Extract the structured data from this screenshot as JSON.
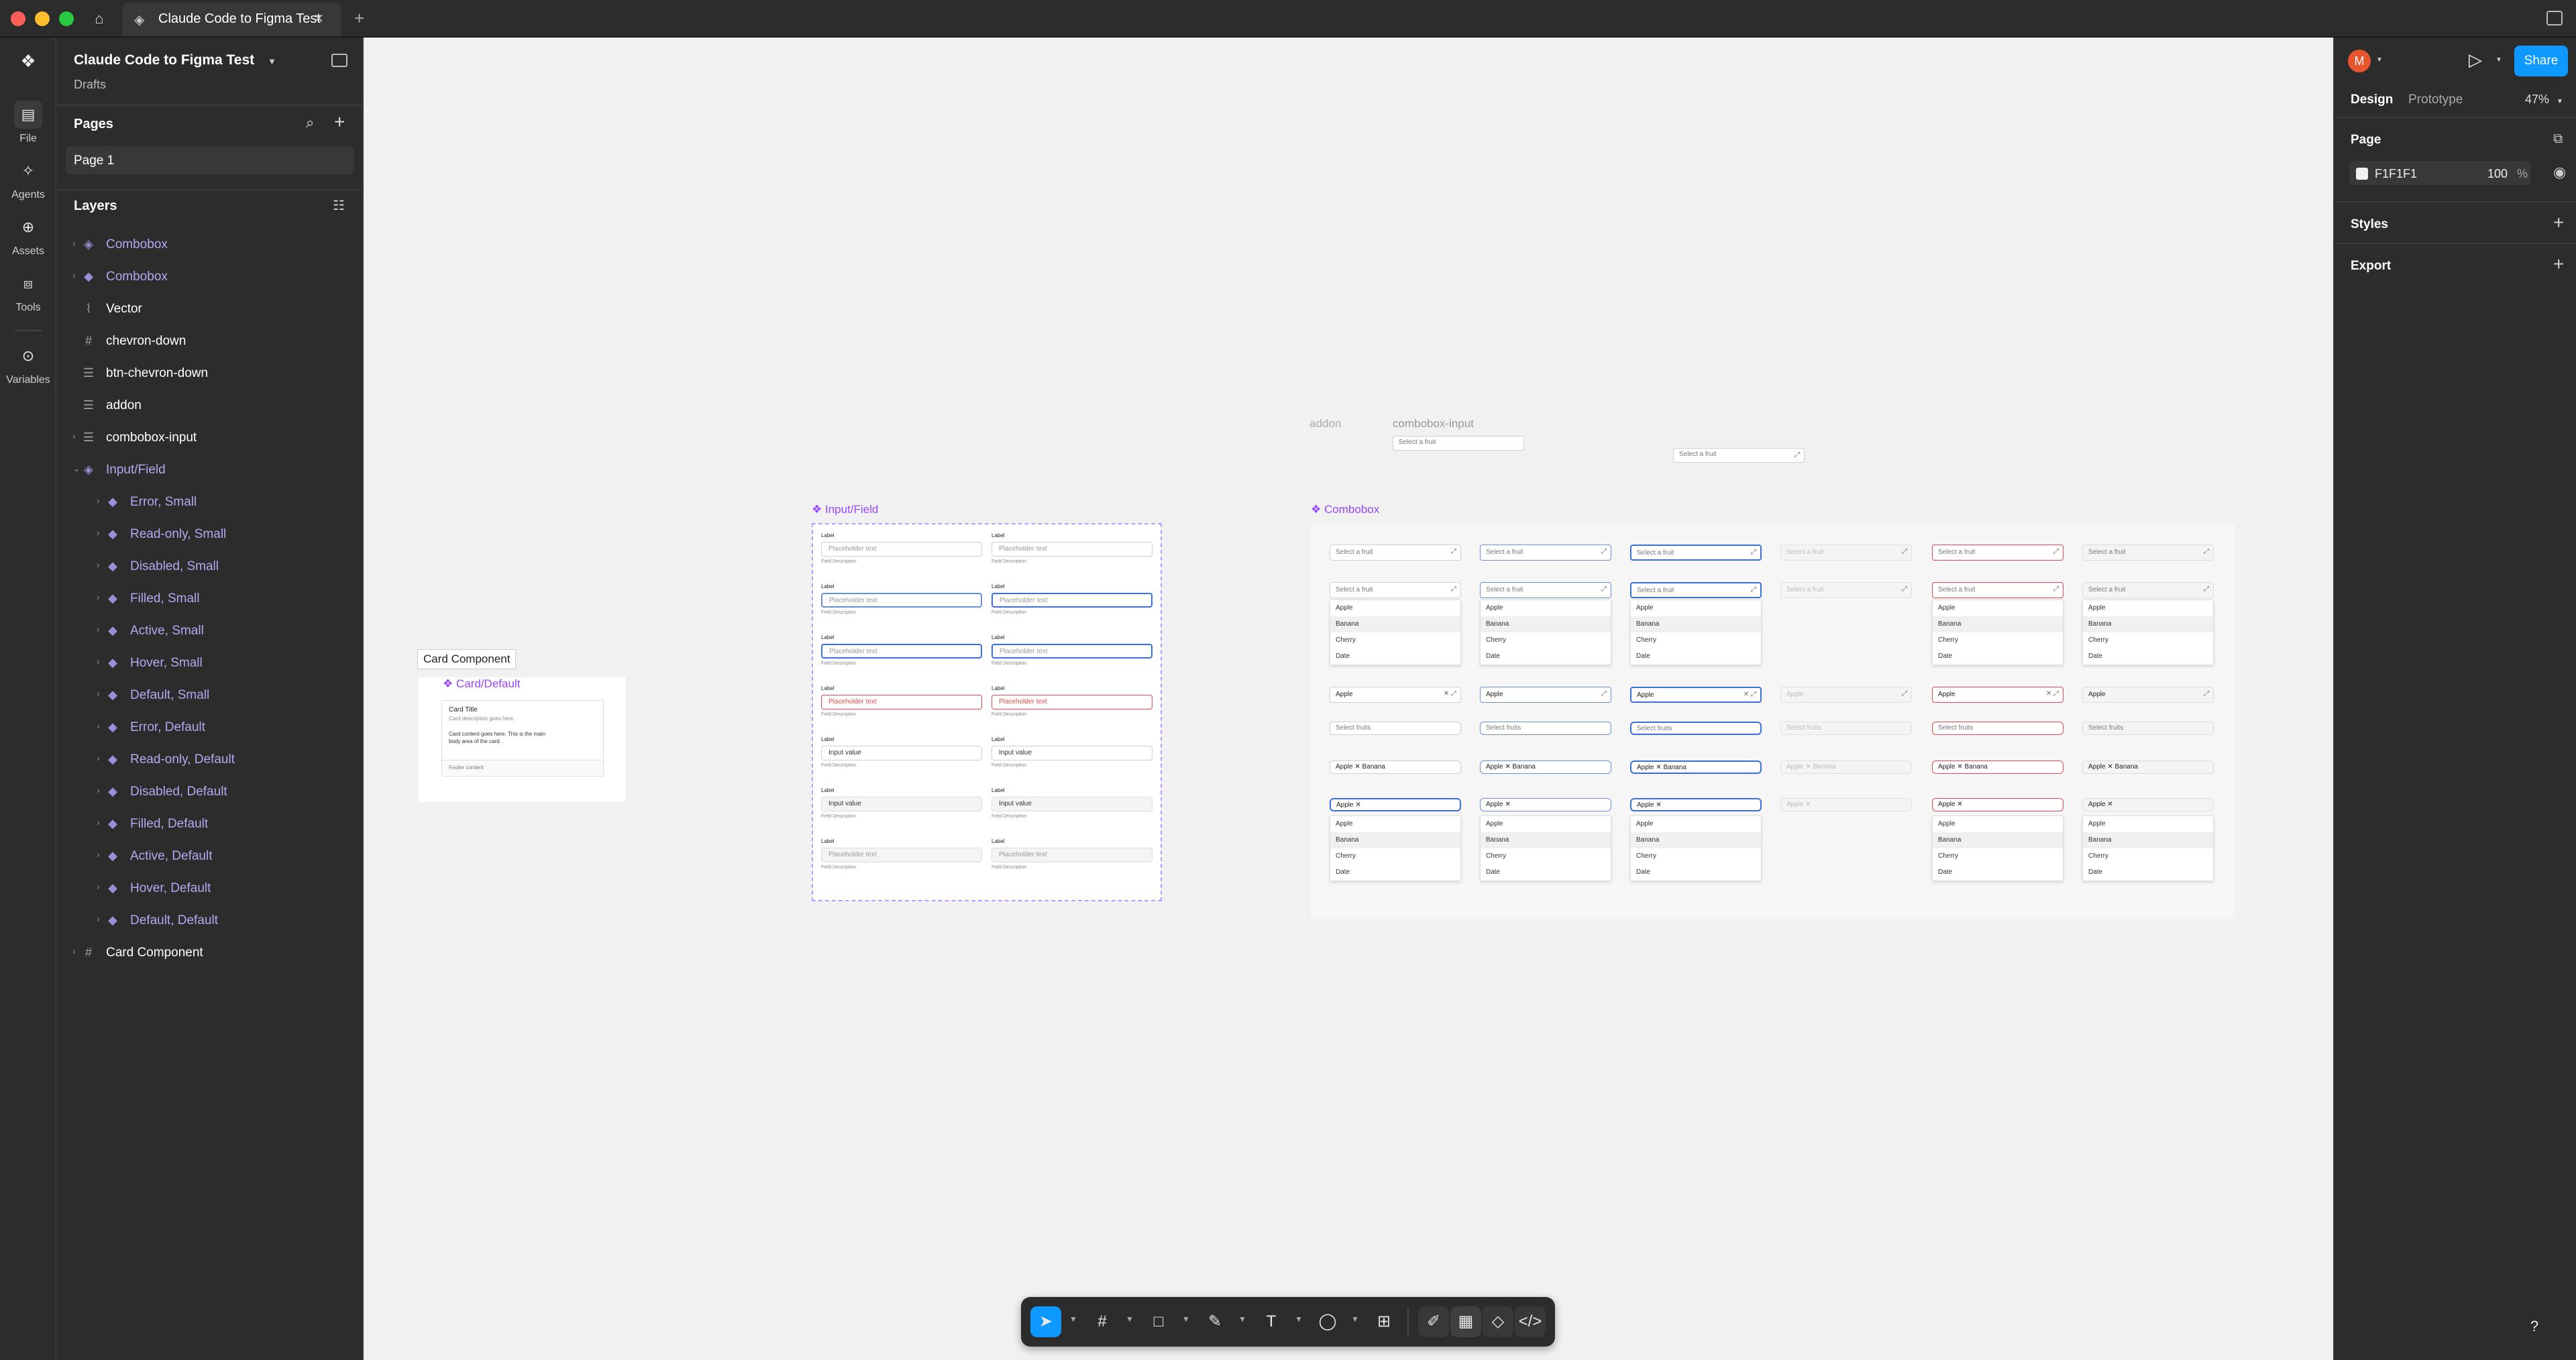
{
  "window": {
    "tab_title": "Claude Code to Figma Test",
    "new_tab": "+"
  },
  "rail": {
    "items": [
      {
        "label": "File",
        "icon": "file-icon"
      },
      {
        "label": "Agents",
        "icon": "agents-icon"
      },
      {
        "label": "Assets",
        "icon": "assets-icon"
      },
      {
        "label": "Tools",
        "icon": "tools-icon"
      },
      {
        "label": "Variables",
        "icon": "variables-icon"
      }
    ]
  },
  "file": {
    "name": "Claude Code to Figma Test",
    "location": "Drafts"
  },
  "pages": {
    "title": "Pages",
    "items": [
      "Page 1"
    ]
  },
  "layers": {
    "title": "Layers",
    "items": [
      {
        "label": "Combobox",
        "icon": "component-set-icon",
        "purple": true
      },
      {
        "label": "Combobox",
        "icon": "component-icon",
        "purple": true
      },
      {
        "label": "Vector",
        "icon": "vector-icon",
        "purple": false
      },
      {
        "label": "chevron-down",
        "icon": "frame-icon",
        "purple": false
      },
      {
        "label": "btn-chevron-down",
        "icon": "autolayout-icon",
        "purple": false
      },
      {
        "label": "addon",
        "icon": "autolayout-icon",
        "purple": false
      },
      {
        "label": "combobox-input",
        "icon": "autolayout-icon",
        "purple": false
      },
      {
        "label": "Input/Field",
        "icon": "component-set-icon",
        "purple": true
      },
      {
        "label": "Error, Small",
        "icon": "component-icon",
        "purple": true
      },
      {
        "label": "Read-only, Small",
        "icon": "component-icon",
        "purple": true
      },
      {
        "label": "Disabled, Small",
        "icon": "component-icon",
        "purple": true
      },
      {
        "label": "Filled, Small",
        "icon": "component-icon",
        "purple": true
      },
      {
        "label": "Active, Small",
        "icon": "component-icon",
        "purple": true
      },
      {
        "label": "Hover, Small",
        "icon": "component-icon",
        "purple": true
      },
      {
        "label": "Default, Small",
        "icon": "component-icon",
        "purple": true
      },
      {
        "label": "Error, Default",
        "icon": "component-icon",
        "purple": true
      },
      {
        "label": "Read-only, Default",
        "icon": "component-icon",
        "purple": true
      },
      {
        "label": "Disabled, Default",
        "icon": "component-icon",
        "purple": true
      },
      {
        "label": "Filled, Default",
        "icon": "component-icon",
        "purple": true
      },
      {
        "label": "Active, Default",
        "icon": "component-icon",
        "purple": true
      },
      {
        "label": "Hover, Default",
        "icon": "component-icon",
        "purple": true
      },
      {
        "label": "Default, Default",
        "icon": "component-icon",
        "purple": true
      },
      {
        "label": "Card Component",
        "icon": "frame-icon",
        "purple": false
      }
    ]
  },
  "canvas": {
    "addon_label": "addon",
    "combobox_input_label": "combobox-input",
    "select_fruit": "Select a fruit",
    "select_fruits": "Select fruits",
    "input_field_title": "Input/Field",
    "combobox_title": "Combobox",
    "card_component_label": "Card Component",
    "card_default_title": "Card/Default",
    "card": {
      "title": "Card Title",
      "description": "Card description goes here.",
      "body": "Card content goes here. This is the main body area of the card.",
      "footer": "Footer content"
    },
    "field_label": "Label",
    "field_description": "Field Description",
    "placeholder": "Placeholder text",
    "input_value": "Input value",
    "fruits": [
      "Apple",
      "Banana",
      "Cherry",
      "Date"
    ],
    "apple": "Apple",
    "apple_banana": "Apple ✕  Banana",
    "apple_x": "Apple ✕"
  },
  "right": {
    "user_initial": "M",
    "share": "Share",
    "tabs": [
      "Design",
      "Prototype"
    ],
    "zoom": "47%",
    "page_title": "Page",
    "bg_color": "F1F1F1",
    "opacity": "100",
    "opacity_unit": "%",
    "styles": "Styles",
    "export": "Export"
  },
  "colors": {
    "accent": "#0d99ff",
    "component_purple": "#9747ff",
    "canvas_bg": "#f1f1f1",
    "avatar": "#e8542e",
    "error": "#e5484d",
    "focus": "#3b6fd9"
  },
  "help": "?"
}
